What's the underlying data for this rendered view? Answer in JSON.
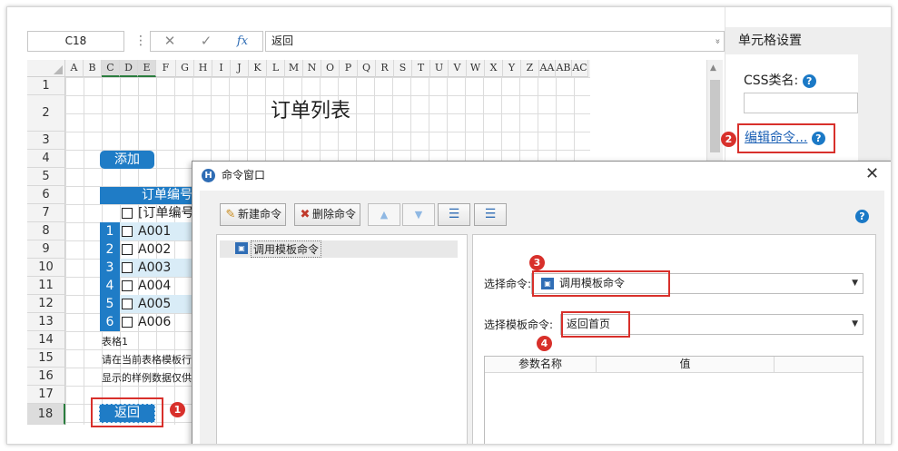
{
  "formula_bar": {
    "name_box": "C18",
    "separator": "⋮",
    "cancel_glyph": "✕",
    "confirm_glyph": "✓",
    "fx_label": "fx",
    "formula": "返回",
    "expand_glyph": "»"
  },
  "right_panel": {
    "title": "单元格设置",
    "css_label": "CSS类名:",
    "edit_command_link": "编辑命令...",
    "help_glyph": "?"
  },
  "sheet": {
    "columns": [
      "A",
      "B",
      "C",
      "D",
      "E",
      "F",
      "G",
      "H",
      "I",
      "J",
      "K",
      "L",
      "M",
      "N",
      "O",
      "P",
      "Q",
      "R",
      "S",
      "T",
      "U",
      "V",
      "W",
      "X",
      "Y",
      "Z",
      "AA",
      "AB",
      "AC"
    ],
    "selected_columns": [
      "C",
      "D",
      "E"
    ],
    "rows": [
      "1",
      "2",
      "3",
      "4",
      "5",
      "6",
      "7",
      "8",
      "9",
      "10",
      "11",
      "12",
      "13",
      "14",
      "15",
      "16",
      "17",
      "18"
    ],
    "selected_row": "18",
    "title": "订单列表",
    "add_button": "添加",
    "table_header": "订单编号",
    "table_subheader": "[订单编号]",
    "table_rows": [
      {
        "num": "1",
        "value": "A001"
      },
      {
        "num": "2",
        "value": "A002"
      },
      {
        "num": "3",
        "value": "A003"
      },
      {
        "num": "4",
        "value": "A004"
      },
      {
        "num": "5",
        "value": "A005"
      },
      {
        "num": "6",
        "value": "A006"
      }
    ],
    "notes": [
      "表格1",
      "请在当前表格模板行",
      "显示的样例数据仅供"
    ],
    "back_button": "返回"
  },
  "dialog": {
    "title": "命令窗口",
    "logo_glyph": "H",
    "close_glyph": "✕",
    "toolbar": {
      "new_command": "新建命令",
      "delete_command": "删除命令",
      "up_glyph": "▲",
      "down_glyph": "▼",
      "indent_glyph": "☰",
      "outdent_glyph": "☰"
    },
    "help_glyph": "?",
    "tree_items": [
      "调用模板命令"
    ],
    "select_command_label": "选择命令:",
    "select_command_value": "调用模板命令",
    "select_template_label": "选择模板命令:",
    "select_template_value": "返回首页",
    "dropdown_glyph": "▼",
    "param_table": {
      "col_name": "参数名称",
      "col_value": "值"
    }
  },
  "badges": [
    "1",
    "2",
    "3",
    "4"
  ],
  "colors": {
    "accent": "#1f7cc6",
    "highlight": "#d8302b",
    "row_alt": "#d9ecf7",
    "selection": "#2a7d3e"
  }
}
